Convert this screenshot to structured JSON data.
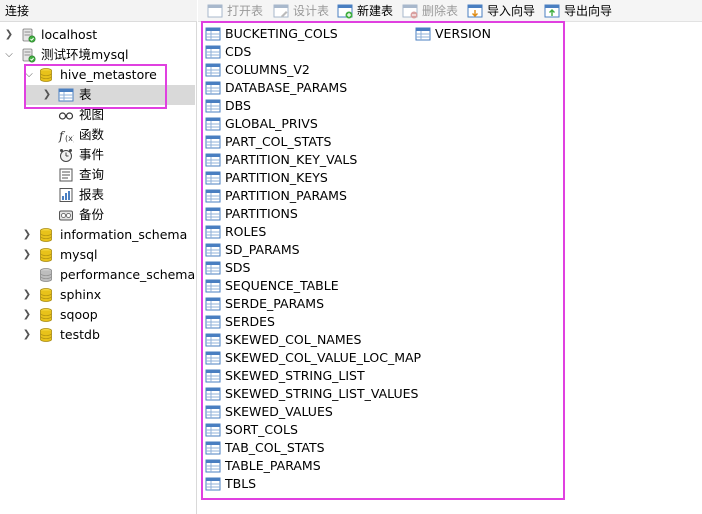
{
  "connection_panel": {
    "title": "连接",
    "tree": [
      {
        "label": "localhost",
        "icon": "server-icon",
        "expander": "collapsed"
      },
      {
        "label": "测试环境mysql",
        "icon": "server-icon",
        "expander": "expanded"
      },
      {
        "label": "hive_metastore",
        "icon": "database-icon",
        "expander": "expanded"
      },
      {
        "label": "表",
        "icon": "table-folder-icon",
        "expander": "collapsed",
        "selected": true
      },
      {
        "label": "视图",
        "icon": "view-icon"
      },
      {
        "label": "函数",
        "icon": "function-icon"
      },
      {
        "label": "事件",
        "icon": "event-icon"
      },
      {
        "label": "查询",
        "icon": "query-icon"
      },
      {
        "label": "报表",
        "icon": "report-icon"
      },
      {
        "label": "备份",
        "icon": "backup-icon"
      },
      {
        "label": "information_schema",
        "icon": "database-icon",
        "expander": "collapsed"
      },
      {
        "label": "mysql",
        "icon": "database-icon",
        "expander": "collapsed"
      },
      {
        "label": "performance_schema",
        "icon": "database-grey-icon"
      },
      {
        "label": "sphinx",
        "icon": "database-icon",
        "expander": "collapsed"
      },
      {
        "label": "sqoop",
        "icon": "database-icon",
        "expander": "collapsed"
      },
      {
        "label": "testdb",
        "icon": "database-icon",
        "expander": "collapsed"
      }
    ]
  },
  "toolbar": {
    "buttons": [
      {
        "label": "打开表",
        "icon": "open-table-icon",
        "enabled": false
      },
      {
        "label": "设计表",
        "icon": "design-table-icon",
        "enabled": false
      },
      {
        "label": "新建表",
        "icon": "new-table-icon",
        "enabled": true
      },
      {
        "label": "删除表",
        "icon": "delete-table-icon",
        "enabled": false
      },
      {
        "label": "导入向导",
        "icon": "import-wizard-icon",
        "enabled": true
      },
      {
        "label": "导出向导",
        "icon": "export-wizard-icon",
        "enabled": true
      }
    ]
  },
  "tables": [
    "BUCKETING_COLS",
    "CDS",
    "COLUMNS_V2",
    "DATABASE_PARAMS",
    "DBS",
    "GLOBAL_PRIVS",
    "PART_COL_STATS",
    "PARTITION_KEY_VALS",
    "PARTITION_KEYS",
    "PARTITION_PARAMS",
    "PARTITIONS",
    "ROLES",
    "SD_PARAMS",
    "SDS",
    "SEQUENCE_TABLE",
    "SERDE_PARAMS",
    "SERDES",
    "SKEWED_COL_NAMES",
    "SKEWED_COL_VALUE_LOC_MAP",
    "SKEWED_STRING_LIST",
    "SKEWED_STRING_LIST_VALUES",
    "SKEWED_VALUES",
    "SORT_COLS",
    "TAB_COL_STATS",
    "TABLE_PARAMS",
    "TBLS",
    "VERSION"
  ],
  "colors": {
    "highlight": "#e040e0",
    "selection": "#d9d9d9",
    "table_icon_blue": "#4a7fc1",
    "database_icon_yellow": "#e8c21a"
  }
}
